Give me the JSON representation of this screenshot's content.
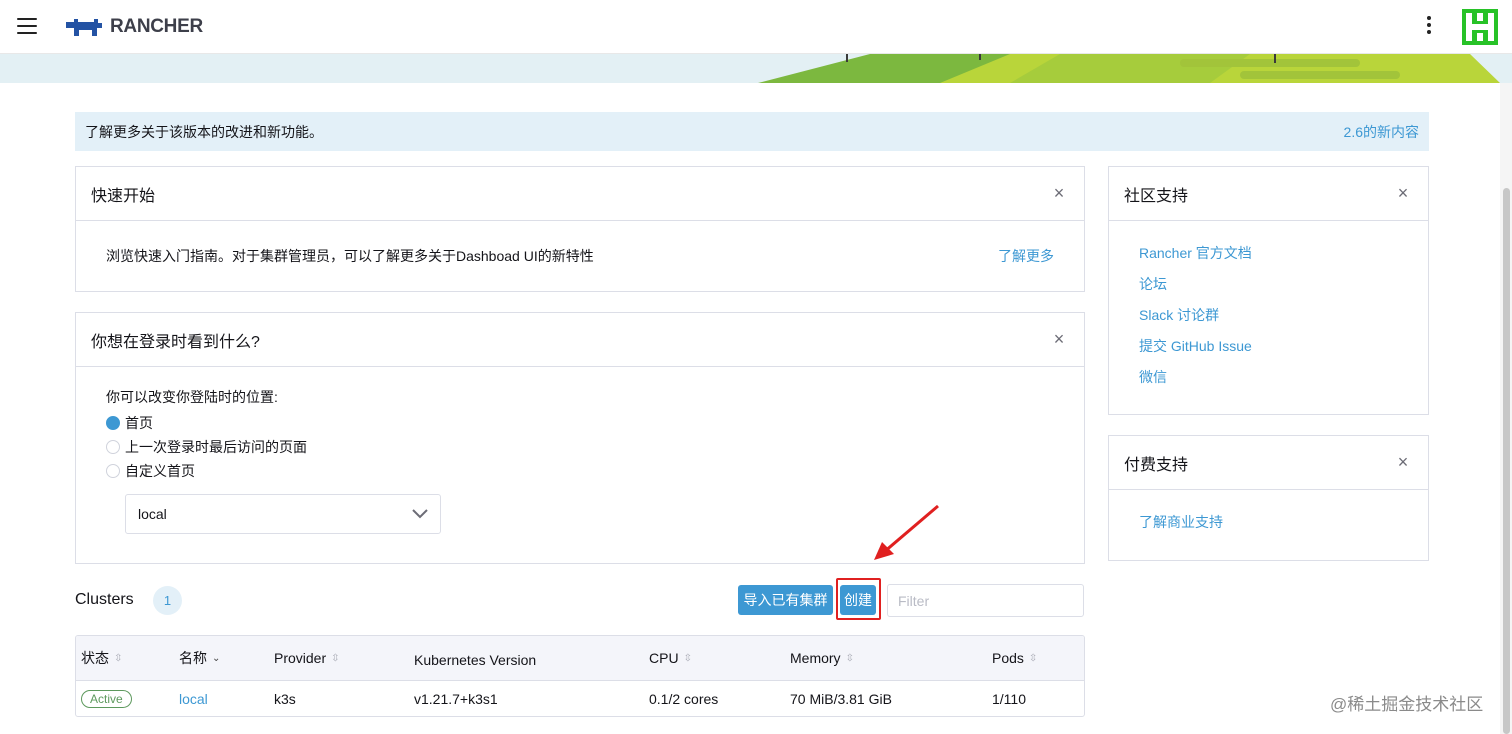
{
  "header": {
    "logo_text": "RANCHER",
    "menu_icon": "hamburger-menu-icon",
    "more_icon": "kebab-menu-icon",
    "avatar_color": "#27c227"
  },
  "infobar": {
    "message": "了解更多关于该版本的改进和新功能。",
    "link": "2.6的新内容"
  },
  "quick_start": {
    "title": "快速开始",
    "body": "浏览快速入门指南。对于集群管理员，可以了解更多关于Dashboad UI的新特性",
    "link": "了解更多"
  },
  "login_panel": {
    "title": "你想在登录时看到什么?",
    "prompt": "你可以改变你登陆时的位置:",
    "options": [
      "首页",
      "上一次登录时最后访问的页面",
      "自定义首页"
    ],
    "selected_option": "首页",
    "select_value": "local"
  },
  "community": {
    "title": "社区支持",
    "links": [
      "Rancher 官方文档",
      "论坛",
      "Slack 讨论群",
      "提交 GitHub Issue",
      "微信"
    ]
  },
  "paid": {
    "title": "付费支持",
    "link": "了解商业支持"
  },
  "clusters": {
    "title": "Clusters",
    "count": "1",
    "import_button": "导入已有集群",
    "create_button": "创建",
    "filter_placeholder": "Filter",
    "columns": [
      "状态",
      "名称",
      "Provider",
      "Kubernetes Version",
      "CPU",
      "Memory",
      "Pods"
    ],
    "rows": [
      {
        "state": "Active",
        "name": "local",
        "provider": "k3s",
        "version": "v1.21.7+k3s1",
        "cpu": "0.1/2 cores",
        "memory": "70 MiB/3.81 GiB",
        "pods": "1/110"
      }
    ]
  },
  "watermark": "@稀土掘金技术社区",
  "colors": {
    "accent": "#3d98d3",
    "highlight": "#e02020",
    "active_badge": "#5d995d"
  }
}
